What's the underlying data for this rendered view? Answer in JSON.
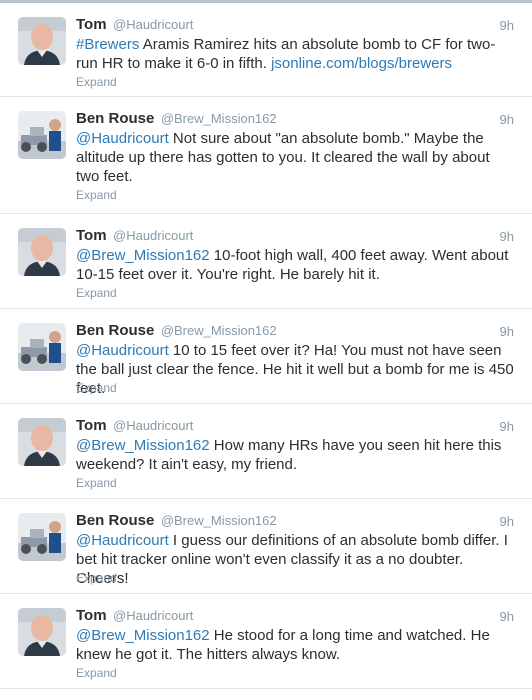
{
  "tweets": [
    {
      "author": "tom",
      "name": "Tom",
      "handle": "@Haudricourt",
      "time": "9h",
      "hashtag": "#Brewers",
      "text_main": " Aramis Ramirez hits an absolute bomb to CF for two-run HR to make it 6-0 in fifth. ",
      "url": "jsonline.com/blogs/brewers",
      "expand": "Expand"
    },
    {
      "author": "ben",
      "name": "Ben Rouse",
      "handle": "@Brew_Mission162",
      "time": "9h",
      "mention": "@Haudricourt",
      "text": " Not sure about \"an absolute bomb.\" Maybe the altitude up there has gotten to you. It cleared the wall by about two feet.",
      "expand": "Expand"
    },
    {
      "author": "tom",
      "name": "Tom",
      "handle": "@Haudricourt",
      "time": "9h",
      "mention": "@Brew_Mission162",
      "text": " 10-foot high wall, 400 feet away. Went about 10-15 feet over it. You're right. He barely hit it.",
      "expand": "Expand"
    },
    {
      "author": "ben",
      "name": "Ben Rouse",
      "handle": "@Brew_Mission162",
      "time": "9h",
      "mention": "@Haudricourt",
      "text": " 10 to 15 feet over it? Ha! You must not have seen the ball just clear the fence. He hit it well but a bomb for me is 450 feet.",
      "expand": "Expand"
    },
    {
      "author": "tom",
      "name": "Tom",
      "handle": "@Haudricourt",
      "time": "9h",
      "mention": "@Brew_Mission162",
      "text": " How many HRs have you seen hit here this weekend? It ain't easy, my friend.",
      "expand": "Expand"
    },
    {
      "author": "ben",
      "name": "Ben Rouse",
      "handle": "@Brew_Mission162",
      "time": "9h",
      "mention": "@Haudricourt",
      "text": " I guess our definitions of an absolute bomb differ. I bet hit tracker online won't even classify it as a no doubter. Cheers!",
      "expand": "Expand"
    },
    {
      "author": "tom",
      "name": "Tom",
      "handle": "@Haudricourt",
      "time": "9h",
      "mention": "@Brew_Mission162",
      "text": " He stood for a long time and watched. He knew he got it. The hitters always know.",
      "expand": "Expand"
    }
  ],
  "colors": {
    "link": "#2b7bb9",
    "name": "#292f33",
    "meta": "#8899a6",
    "divider": "#e3e6e8"
  }
}
